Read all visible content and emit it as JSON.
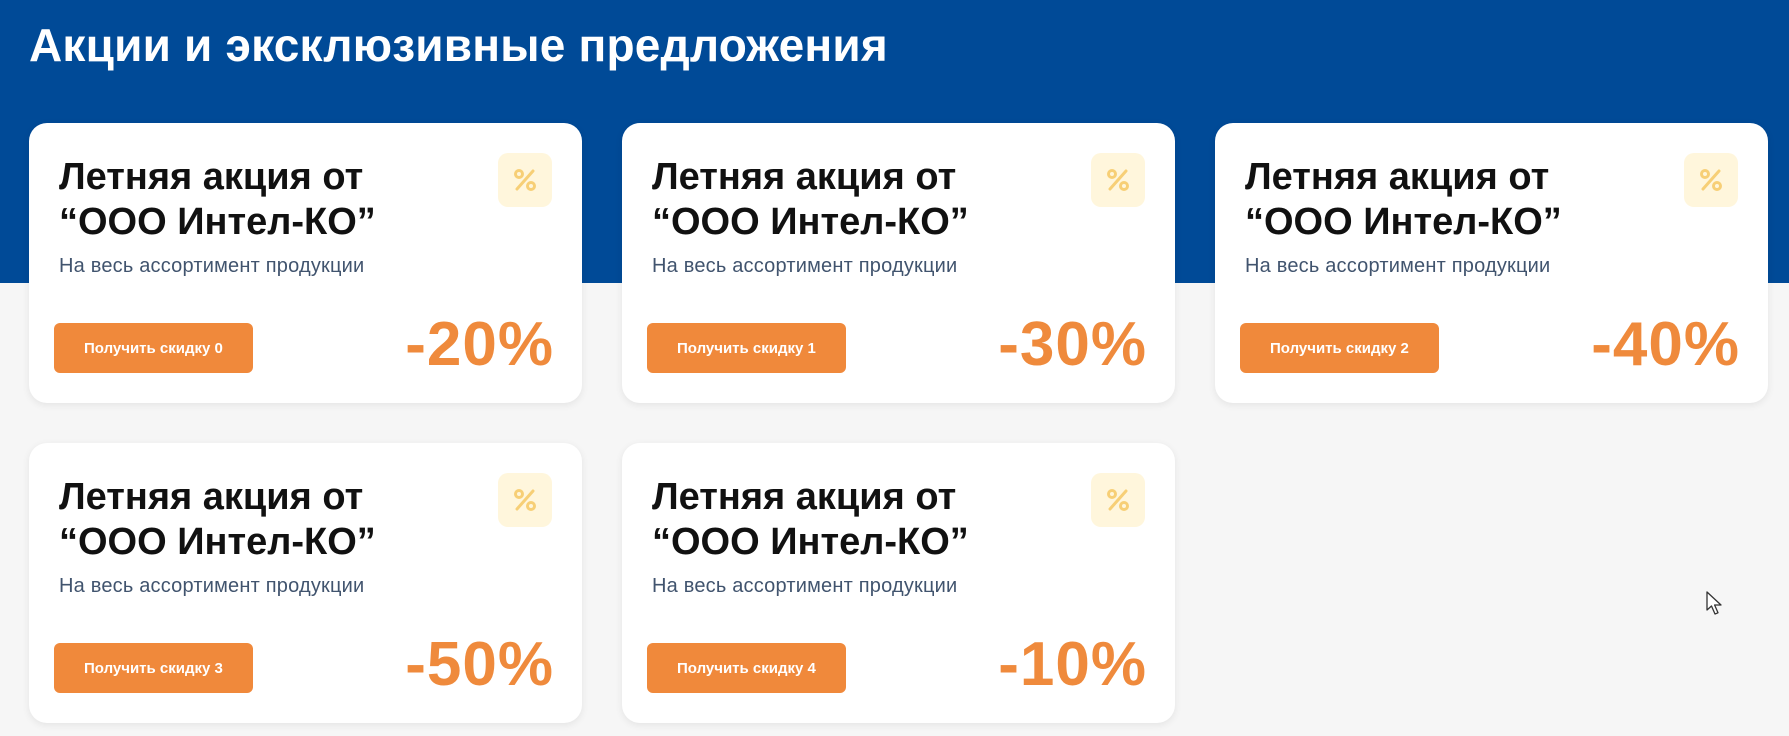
{
  "page": {
    "title": "Акции и эксклюзивные предложения"
  },
  "colors": {
    "band": "#004a97",
    "accent": "#f0893b",
    "badge_bg": "#fff6dc"
  },
  "promos": [
    {
      "title": "Летняя акция от “ООО Интел-КО”",
      "subtitle": "На весь ассортимент продукции",
      "button": "Получить скидку 0",
      "discount": "-20%",
      "icon": "percent-icon"
    },
    {
      "title": "Летняя акция от “ООО Интел-КО”",
      "subtitle": "На весь ассортимент продукции",
      "button": "Получить скидку 1",
      "discount": "-30%",
      "icon": "percent-icon"
    },
    {
      "title": "Летняя акция от “ООО Интел-КО”",
      "subtitle": "На весь ассортимент продукции",
      "button": "Получить скидку 2",
      "discount": "-40%",
      "icon": "percent-icon"
    },
    {
      "title": "Летняя акция от “ООО Интел-КО”",
      "subtitle": "На весь ассортимент продукции",
      "button": "Получить скидку 3",
      "discount": "-50%",
      "icon": "percent-icon"
    },
    {
      "title": "Летняя акция от “ООО Интел-КО”",
      "subtitle": "На весь ассортимент продукции",
      "button": "Получить скидку 4",
      "discount": "-10%",
      "icon": "percent-icon"
    }
  ]
}
